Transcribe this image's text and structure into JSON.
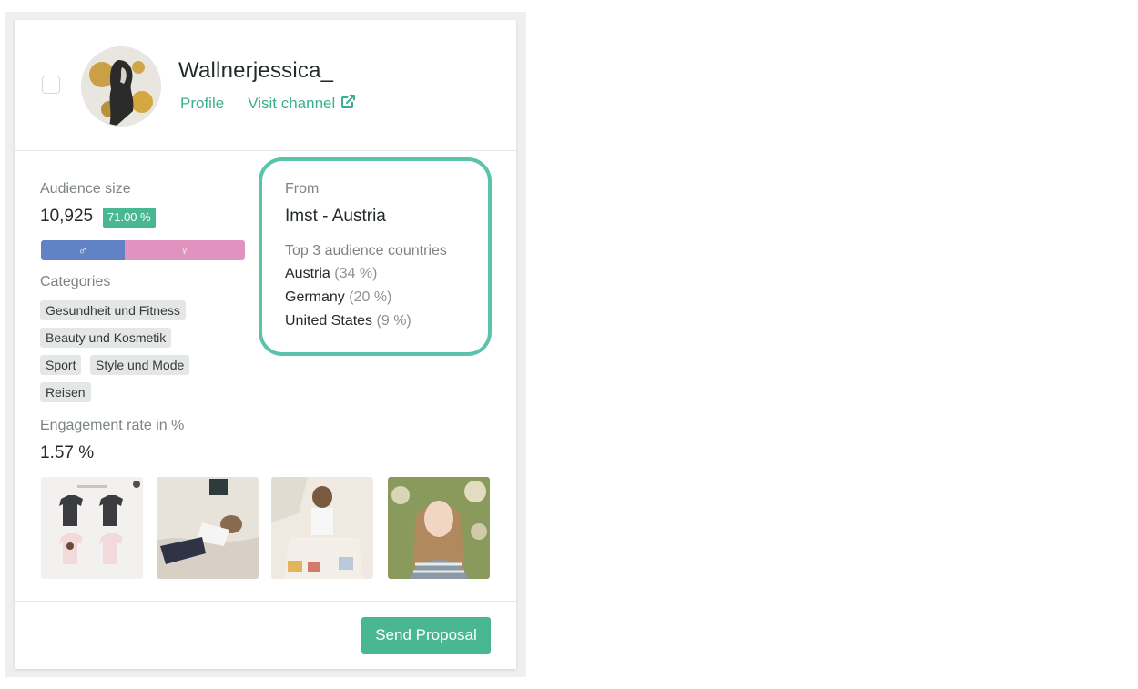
{
  "influencer": {
    "username": "Wallnerjessica_",
    "profile_link": "Profile",
    "visit_channel_link": "Visit channel"
  },
  "audience": {
    "label": "Audience size",
    "size": "10,925",
    "percentage": "71.00 %",
    "gender_split": {
      "male_fraction": 0.41,
      "female_fraction": 0.59
    },
    "male_symbol": "♂",
    "female_symbol": "♀"
  },
  "categories": {
    "label": "Categories",
    "items": [
      "Gesundheit und Fitness",
      "Beauty und Kosmetik",
      "Sport",
      "Style und Mode",
      "Reisen"
    ]
  },
  "engagement": {
    "label": "Engagement rate in %",
    "value": "1.57 %"
  },
  "location": {
    "from_label": "From",
    "from_value": "Imst - Austria",
    "top_countries_label": "Top 3 audience countries",
    "countries": [
      {
        "name": "Austria",
        "share": "(34 %)"
      },
      {
        "name": "Germany",
        "share": "(20 %)"
      },
      {
        "name": "United States",
        "share": "(9 %)"
      }
    ]
  },
  "actions": {
    "send_proposal": "Send Proposal"
  },
  "colors": {
    "accent": "#49b892",
    "highlight_outline": "#5bc3ab",
    "male": "#6282c6",
    "female": "#df93be"
  }
}
